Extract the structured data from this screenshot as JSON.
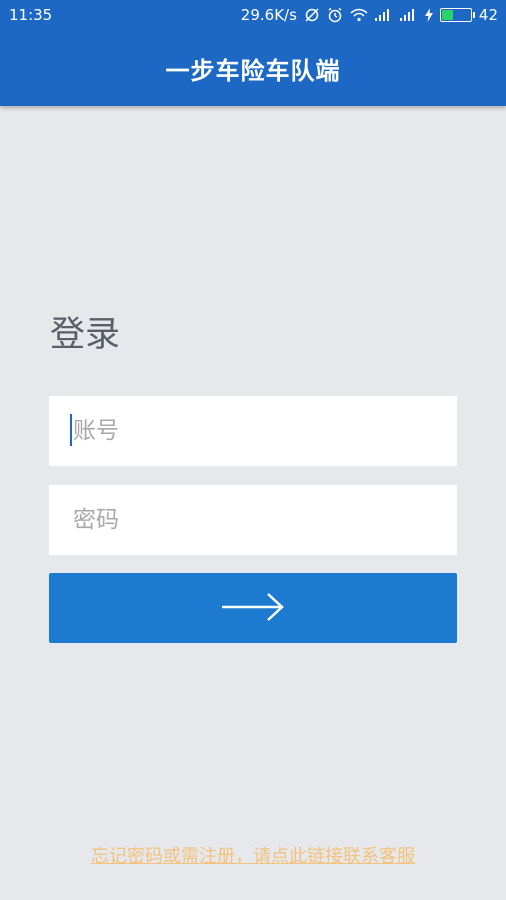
{
  "status_bar": {
    "time": "11:35",
    "net_speed": "29.6K/s",
    "battery_level": "42",
    "battery_fraction": 0.42
  },
  "header": {
    "title": "一步车险车队端"
  },
  "login": {
    "heading": "登录",
    "account_placeholder": "账号",
    "password_placeholder": "密码",
    "submit_icon": "arrow-right-icon"
  },
  "footer": {
    "help_link": "忘记密码或需注册，请点此链接联系客服"
  },
  "colors": {
    "primary": "#1c68c4",
    "button": "#1c7ad0",
    "link": "#f3c27c",
    "background": "#e6e8eb"
  }
}
